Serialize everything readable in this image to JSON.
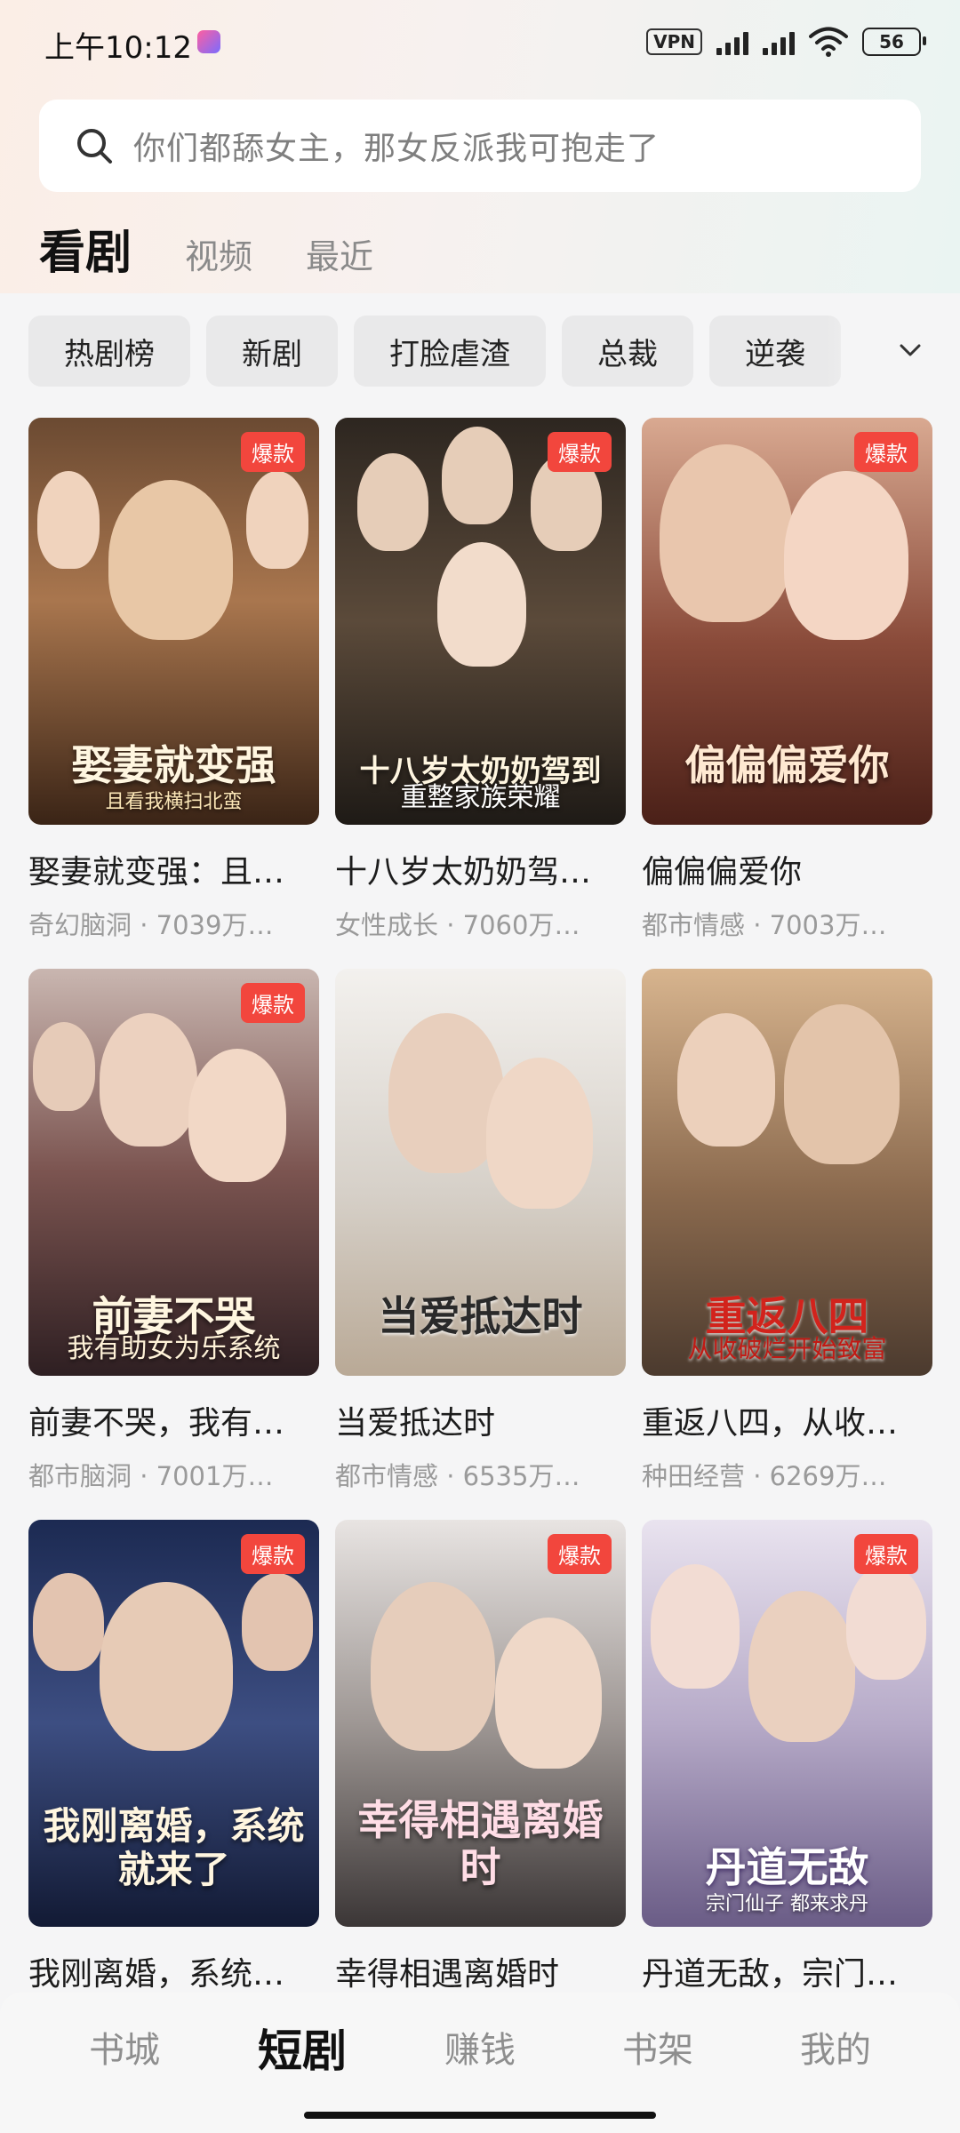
{
  "status_bar": {
    "time": "上午10:12",
    "vpn": "VPN",
    "battery": "56"
  },
  "search": {
    "placeholder": "你们都舔女主，那女反派我可抱走了"
  },
  "main_tabs": [
    {
      "label": "看剧",
      "active": true
    },
    {
      "label": "视频",
      "active": false
    },
    {
      "label": "最近",
      "active": false
    }
  ],
  "chips": [
    "热剧榜",
    "新剧",
    "打脸虐渣",
    "总裁",
    "逆袭"
  ],
  "dramas": [
    {
      "title": "娶妻就变强：且…",
      "meta": "奇幻脑洞 · 7039万…",
      "badge": "爆款",
      "poster_text": "娶妻就变强",
      "poster_sub": "且看我横扫北蛮"
    },
    {
      "title": "十八岁太奶奶驾…",
      "meta": "女性成长 · 7060万…",
      "badge": "爆款",
      "poster_text": "十八岁太奶奶驾到",
      "poster_sub": "重整家族荣耀"
    },
    {
      "title": "偏偏偏爱你",
      "meta": "都市情感 · 7003万…",
      "badge": "爆款",
      "poster_text": "偏偏偏爱你",
      "poster_sub": ""
    },
    {
      "title": "前妻不哭，我有…",
      "meta": "都市脑洞 · 7001万…",
      "badge": "爆款",
      "poster_text": "前妻不哭",
      "poster_sub": "我有助女为乐系统"
    },
    {
      "title": "当爱抵达时",
      "meta": "都市情感 · 6535万…",
      "badge": "",
      "poster_text": "当爱抵达时",
      "poster_sub": ""
    },
    {
      "title": "重返八四，从收…",
      "meta": "种田经营 · 6269万…",
      "badge": "",
      "poster_text": "重返八四",
      "poster_sub": "从收破烂开始致富"
    },
    {
      "title": "我刚离婚，系统…",
      "meta": "",
      "badge": "爆款",
      "poster_text": "我刚离婚，系统就来了",
      "poster_sub": ""
    },
    {
      "title": "幸得相遇离婚时",
      "meta": "",
      "badge": "爆款",
      "poster_text": "幸得相遇离婚时",
      "poster_sub": ""
    },
    {
      "title": "丹道无敌，宗门…",
      "meta": "",
      "badge": "爆款",
      "poster_text": "丹道无敌",
      "poster_sub": "宗门仙子 都来求丹"
    }
  ],
  "bottom_nav": [
    {
      "label": "书城",
      "active": false
    },
    {
      "label": "短剧",
      "active": true
    },
    {
      "label": "赚钱",
      "active": false
    },
    {
      "label": "书架",
      "active": false
    },
    {
      "label": "我的",
      "active": false
    }
  ],
  "colors": {
    "badge": "#f2463d",
    "active_text": "#111111",
    "inactive_text": "#8a8a8a"
  },
  "icons": [
    "search-icon",
    "wifi-icon",
    "signal-icon",
    "battery-icon",
    "chevron-down-icon"
  ]
}
